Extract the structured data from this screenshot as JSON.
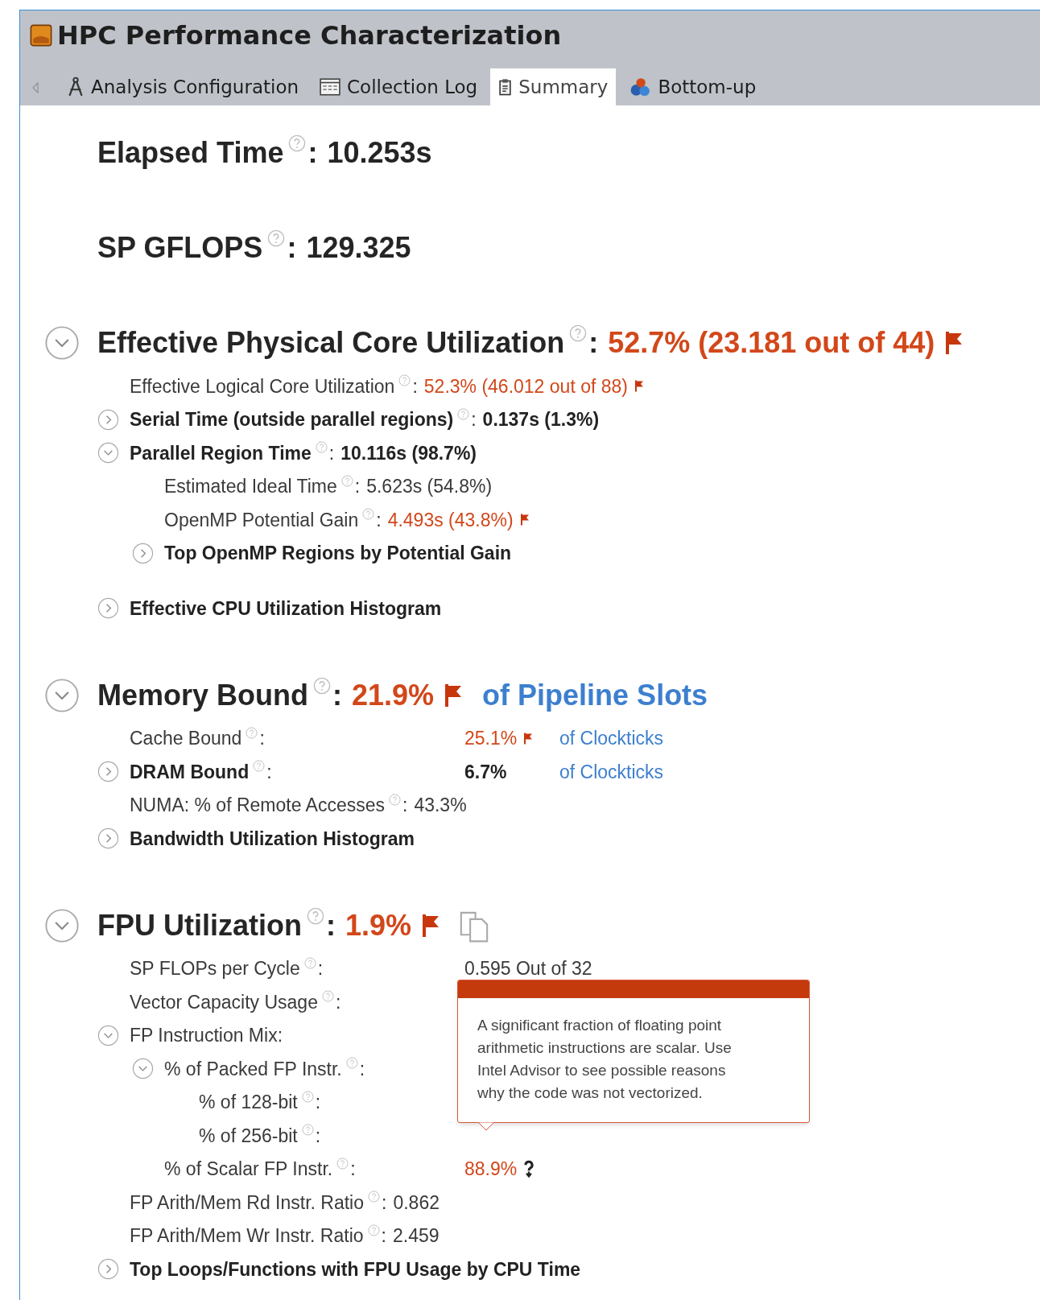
{
  "window": {
    "title": "HPC Performance Characterization"
  },
  "tabs": [
    {
      "label": "Analysis Configuration",
      "kind": "config",
      "selected": false
    },
    {
      "label": "Collection Log",
      "kind": "log",
      "selected": false
    },
    {
      "label": "Summary",
      "kind": "summary",
      "selected": true
    },
    {
      "label": "Bottom-up",
      "kind": "bottomup",
      "selected": false
    }
  ],
  "sections": [
    {
      "kind": "headline",
      "label": "Elapsed Time",
      "help": true,
      "suffix": ":",
      "value": "10.253s",
      "alert": false
    },
    {
      "kind": "headline",
      "label": "SP GFLOPS",
      "help": true,
      "suffix": ":",
      "value": "129.325",
      "alert": false
    },
    {
      "kind": "group",
      "label": "Effective Physical Core Utilization",
      "help": true,
      "suffix": ":",
      "value": "52.7% (23.181 out of 44)",
      "alert": true,
      "flag": true,
      "expanded": true,
      "items": [
        {
          "kind": "metric",
          "label": "Effective Logical Core Utilization",
          "help": true,
          "suffix": ":",
          "value": "52.3% (46.012 out of 88)",
          "alert": true,
          "flag": true
        },
        {
          "kind": "section",
          "label": "Serial Time (outside parallel regions)",
          "help": true,
          "suffix": ":",
          "value": "0.137s (1.3%)",
          "alert": false,
          "expanded": false
        },
        {
          "kind": "section",
          "label": "Parallel Region Time",
          "help": true,
          "suffix": ":",
          "value": "10.116s (98.7%)",
          "alert": false,
          "expanded": true,
          "children": [
            {
              "kind": "metric",
              "label": "Estimated Ideal Time",
              "help": true,
              "suffix": ":",
              "value": "5.623s (54.8%)",
              "alert": false
            },
            {
              "kind": "metric",
              "label": "OpenMP Potential Gain",
              "help": true,
              "suffix": ":",
              "value": "4.493s (43.8%)",
              "alert": true,
              "flag": true
            },
            {
              "kind": "section",
              "label": "Top OpenMP Regions by Potential Gain",
              "help": false,
              "expanded": false
            }
          ]
        },
        {
          "kind": "section",
          "label": "Effective CPU Utilization Histogram",
          "help": false,
          "expanded": false
        }
      ]
    },
    {
      "kind": "group",
      "label": "Memory Bound",
      "help": true,
      "suffix": ":",
      "value": "21.9%",
      "alert": true,
      "flag": true,
      "unit": "of Pipeline Slots",
      "expanded": true,
      "items": [
        {
          "kind": "metric",
          "label": "Cache Bound",
          "help": true,
          "suffix": ":",
          "tabular": true,
          "value": "25.1%",
          "alert": true,
          "flag": true,
          "unit": "of Clockticks"
        },
        {
          "kind": "section",
          "label": "DRAM Bound",
          "help": true,
          "suffix": ":",
          "tabular": true,
          "value": "6.7%",
          "alert": false,
          "unit": "of Clockticks",
          "expanded": false
        },
        {
          "kind": "metric",
          "label": "NUMA: % of Remote Accesses",
          "help": true,
          "suffix": ":",
          "value": "43.3%",
          "alert": false
        },
        {
          "kind": "section",
          "label": "Bandwidth Utilization Histogram",
          "help": false,
          "expanded": false
        }
      ]
    },
    {
      "kind": "group",
      "label": "FPU Utilization",
      "help": true,
      "suffix": ":",
      "value": "1.9%",
      "alert": true,
      "flag": true,
      "copy_button": true,
      "expanded": true,
      "tooltip": {
        "text": "A significant fraction of floating point arithmetic instructions are scalar. Use Intel Advisor to see possible reasons why the code was not vectorized."
      },
      "items": [
        {
          "kind": "metric",
          "label": "SP FLOPs per Cycle",
          "help": true,
          "suffix": ":",
          "tabular": true,
          "value": "0.595 Out of 32",
          "alert": false
        },
        {
          "kind": "metric",
          "label": "Vector Capacity Usage",
          "help": true,
          "suffix": ":",
          "tabular": true
        },
        {
          "kind": "metric",
          "label": "FP Instruction Mix:",
          "help": false,
          "expanded": true,
          "children": [
            {
              "kind": "metric",
              "label": "% of Packed FP Instr.",
              "help": true,
              "suffix": ":",
              "tabular": true,
              "expanded": true,
              "children": [
                {
                  "kind": "metric",
                  "label": "% of 128-bit",
                  "help": true,
                  "suffix": ":",
                  "tabular": true
                },
                {
                  "kind": "metric",
                  "label": "% of 256-bit",
                  "help": true,
                  "suffix": ":",
                  "tabular": true
                }
              ]
            },
            {
              "kind": "metric",
              "label": "% of Scalar FP Instr.",
              "help": true,
              "suffix": ":",
              "tabular": true,
              "value": "88.9%",
              "alert": true,
              "uncertain": true
            }
          ]
        },
        {
          "kind": "metric",
          "label": "FP Arith/Mem Rd Instr. Ratio",
          "help": true,
          "suffix": ":",
          "value": "0.862",
          "alert": false
        },
        {
          "kind": "metric",
          "label": "FP Arith/Mem Wr Instr. Ratio",
          "help": true,
          "suffix": ":",
          "value": "2.459",
          "alert": false
        },
        {
          "kind": "section",
          "label": "Top Loops/Functions with FPU Usage by CPU Time",
          "help": false,
          "expanded": false
        }
      ]
    }
  ]
}
